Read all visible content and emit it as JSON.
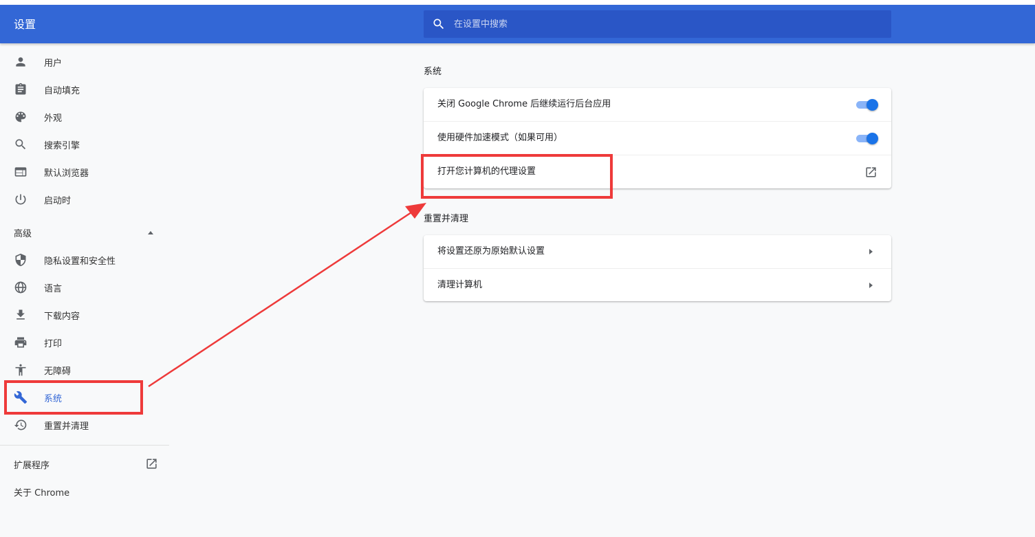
{
  "header": {
    "title": "设置",
    "search_placeholder": "在设置中搜索"
  },
  "sidebar": {
    "items": [
      {
        "label": "用户",
        "icon": "person-icon"
      },
      {
        "label": "自动填充",
        "icon": "clipboard-icon"
      },
      {
        "label": "外观",
        "icon": "palette-icon"
      },
      {
        "label": "搜索引擎",
        "icon": "search-icon"
      },
      {
        "label": "默认浏览器",
        "icon": "browser-window-icon"
      },
      {
        "label": "启动时",
        "icon": "power-icon"
      }
    ],
    "advanced_label": "高级",
    "advanced_items": [
      {
        "label": "隐私设置和安全性",
        "icon": "shield-icon"
      },
      {
        "label": "语言",
        "icon": "globe-icon"
      },
      {
        "label": "下载内容",
        "icon": "download-icon"
      },
      {
        "label": "打印",
        "icon": "printer-icon"
      },
      {
        "label": "无障碍",
        "icon": "accessibility-icon"
      },
      {
        "label": "系统",
        "icon": "wrench-icon",
        "active": true
      },
      {
        "label": "重置并清理",
        "icon": "restore-icon"
      }
    ],
    "extensions_label": "扩展程序",
    "about_label": "关于 Chrome"
  },
  "main": {
    "system": {
      "title": "系统",
      "rows": [
        {
          "label": "关闭 Google Chrome 后继续运行后台应用",
          "control": "toggle",
          "enabled": true
        },
        {
          "label": "使用硬件加速模式（如果可用）",
          "control": "toggle",
          "enabled": true
        },
        {
          "label": "打开您计算机的代理设置",
          "control": "external-link"
        }
      ]
    },
    "reset": {
      "title": "重置并清理",
      "rows": [
        {
          "label": "将设置还原为原始默认设置"
        },
        {
          "label": "清理计算机"
        }
      ]
    }
  },
  "colors": {
    "header": "#3367d6",
    "search_bg": "#2a56c6",
    "active": "#3367d6",
    "toggle": "#1a73e8",
    "annotation": "#ee3a3a",
    "page_bg": "#f8f9fa"
  }
}
